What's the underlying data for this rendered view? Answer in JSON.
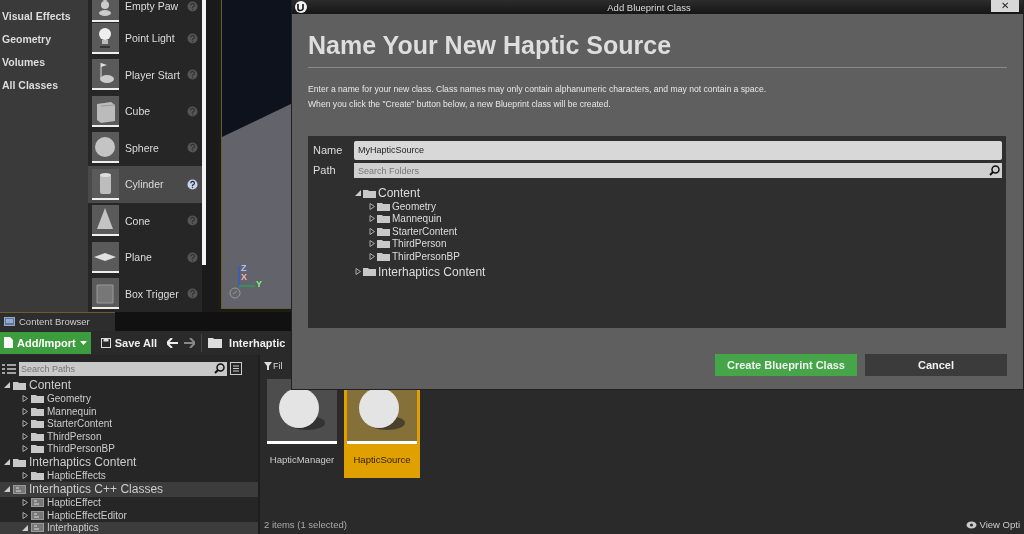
{
  "categories": [
    {
      "label": "Visual Effects"
    },
    {
      "label": "Geometry"
    },
    {
      "label": "Volumes"
    },
    {
      "label": "All Classes"
    }
  ],
  "actors": [
    {
      "label": "Empty Paw",
      "kind": "pawn",
      "selected": false
    },
    {
      "label": "Point Light",
      "kind": "light",
      "selected": false
    },
    {
      "label": "Player Start",
      "kind": "start",
      "selected": false
    },
    {
      "label": "Cube",
      "kind": "cube",
      "selected": false
    },
    {
      "label": "Sphere",
      "kind": "sphere",
      "selected": false
    },
    {
      "label": "Cylinder",
      "kind": "cylinder",
      "selected": true
    },
    {
      "label": "Cone",
      "kind": "cone",
      "selected": false
    },
    {
      "label": "Plane",
      "kind": "plane",
      "selected": false
    },
    {
      "label": "Box Trigger",
      "kind": "box",
      "selected": false
    }
  ],
  "viewport": {
    "axes": [
      "Z",
      "X",
      "Y"
    ]
  },
  "content_browser": {
    "tab": "Content Browser",
    "add_button": "Add/Import",
    "save_button": "Save All",
    "breadcrumb": "Interhaptic",
    "search": {
      "placeholder": "Search Paths"
    },
    "tree": [
      {
        "label": "Content",
        "kind": "folder",
        "expanded": true,
        "selected": false,
        "children": [
          {
            "label": "Geometry",
            "kind": "folder",
            "expanded": false,
            "selected": false
          },
          {
            "label": "Mannequin",
            "kind": "folder",
            "expanded": false,
            "selected": false
          },
          {
            "label": "StarterContent",
            "kind": "folder",
            "expanded": false,
            "selected": false
          },
          {
            "label": "ThirdPerson",
            "kind": "folder",
            "expanded": false,
            "selected": false
          },
          {
            "label": "ThirdPersonBP",
            "kind": "folder",
            "expanded": false,
            "selected": false
          }
        ]
      },
      {
        "label": "Interhaptics Content",
        "kind": "folder",
        "expanded": true,
        "selected": false,
        "children": [
          {
            "label": "HapticEffects",
            "kind": "folder",
            "expanded": false,
            "selected": false
          }
        ]
      },
      {
        "label": "Interhaptics C++ Classes",
        "kind": "code",
        "expanded": true,
        "selected": true,
        "children": [
          {
            "label": "HapticEffect",
            "kind": "code",
            "expanded": false,
            "selected": false
          },
          {
            "label": "HapticEffectEditor",
            "kind": "code",
            "expanded": false,
            "selected": false
          },
          {
            "label": "Interhaptics",
            "kind": "code",
            "expanded": true,
            "selected": true
          }
        ]
      }
    ],
    "filter_button": "Fil",
    "assets": [
      {
        "label": "HapticManager",
        "selected": false
      },
      {
        "label": "HapticSource",
        "selected": true
      }
    ],
    "status": "2 items (1 selected)",
    "view_options": "View Opti"
  },
  "dialog": {
    "title": "Add Blueprint Class",
    "close": "✕",
    "heading": "Name Your New Haptic Source",
    "description": [
      "Enter a name for your new class. Class names may only contain alphanumeric characters, and may not contain a space.",
      "When you click the \"Create\" button below, a new Blueprint class will be created."
    ],
    "name_label": "Name",
    "name_value": "MyHapticSource",
    "path_label": "Path",
    "path_search": {
      "placeholder": "Search Folders"
    },
    "folders": [
      {
        "label": "Content",
        "expanded": true,
        "children": [
          {
            "label": "Geometry",
            "expanded": false
          },
          {
            "label": "Mannequin",
            "expanded": false
          },
          {
            "label": "StarterContent",
            "expanded": false
          },
          {
            "label": "ThirdPerson",
            "expanded": false
          },
          {
            "label": "ThirdPersonBP",
            "expanded": false
          }
        ]
      },
      {
        "label": "Interhaptics Content",
        "expanded": false
      }
    ],
    "buttons": [
      {
        "label": "Create Blueprint Class",
        "kind": "primary"
      },
      {
        "label": "Cancel",
        "kind": "secondary"
      }
    ]
  }
}
